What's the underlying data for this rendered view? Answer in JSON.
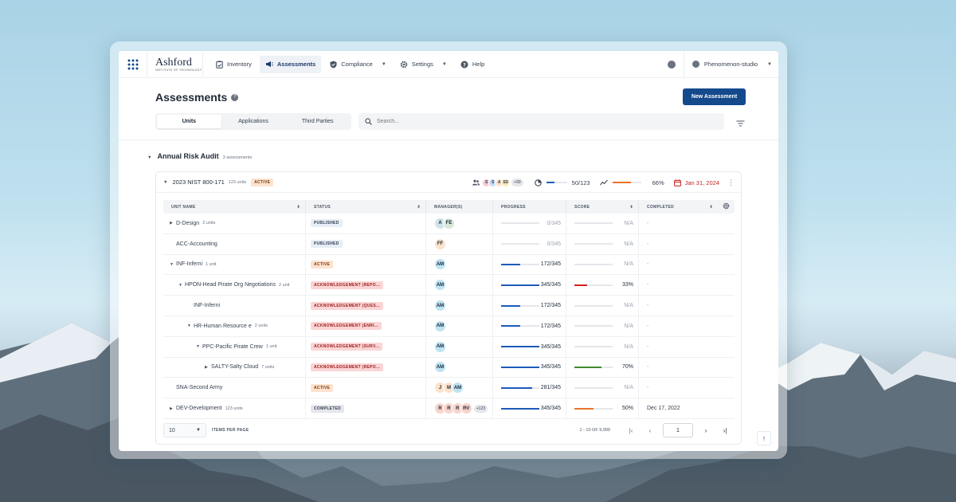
{
  "colors": {
    "brand": "#144a8c",
    "progress": "#1d5bb8",
    "score_orange": "#e8742a",
    "score_red": "#d21f1f",
    "score_green": "#3f8a2e"
  },
  "nav": {
    "brand_name": "Ashford",
    "brand_sub": "INSTITUTE OF TECHNOLOGY",
    "items": [
      {
        "label": "Inventory",
        "icon": "clipboard-icon"
      },
      {
        "label": "Assessments",
        "icon": "megaphone-icon"
      },
      {
        "label": "Compliance",
        "icon": "shield-check-icon"
      },
      {
        "label": "Settings",
        "icon": "gear-icon"
      },
      {
        "label": "Help",
        "icon": "help-icon"
      }
    ],
    "user": "Phenomenon-studio"
  },
  "page": {
    "title": "Assessments",
    "new_button": "New Assessment",
    "tabs": [
      "Units",
      "Applications",
      "Third Parties"
    ],
    "search_placeholder": "Search..."
  },
  "group": {
    "title": "Annual Risk Audit",
    "count": "3 assessments"
  },
  "assessment": {
    "title": "2023 NIST 800-171",
    "units": "123 units",
    "status": "ACTIVE",
    "managers": [
      "S",
      "S",
      "A",
      "SD"
    ],
    "managers_more": "+99",
    "progress_text": "50/123",
    "progress_value": 0.41,
    "score_text": "66%",
    "score_value": 0.66,
    "due_date": "Jan 31, 2024"
  },
  "table": {
    "headers": [
      "UNIT NAME",
      "STATUS",
      "MANAGER(S)",
      "PROGRESS",
      "SCORE",
      "COMPLETED"
    ],
    "rows": [
      {
        "indent": 0,
        "caret": "right",
        "name": "D-Design",
        "sub": "2 units",
        "status": "PUBLISHED",
        "status_kind": "published",
        "managers": [
          {
            "i": "A",
            "c": "#cfe3ec"
          },
          {
            "i": "FE",
            "c": "#d7e7d9"
          }
        ],
        "more": "",
        "progress": "0/345",
        "pv": 0,
        "score": "N/A",
        "sv": 0,
        "sc": "",
        "completed": "-"
      },
      {
        "indent": 0,
        "caret": "",
        "name": "ACC-Accounting",
        "sub": "",
        "status": "PUBLISHED",
        "status_kind": "published",
        "managers": [
          {
            "i": "FF",
            "c": "#fbe3cc"
          }
        ],
        "more": "",
        "progress": "0/345",
        "pv": 0,
        "score": "N/A",
        "sv": 0,
        "sc": "",
        "completed": "-"
      },
      {
        "indent": 0,
        "caret": "down",
        "name": "INF-Inferni",
        "sub": "1 unit",
        "status": "ACTIVE",
        "status_kind": "active",
        "managers": [
          {
            "i": "AM",
            "c": "#bfe3f2"
          }
        ],
        "more": "",
        "progress": "172/345",
        "pv": 0.5,
        "score": "N/A",
        "sv": 0,
        "sc": "",
        "completed": "-"
      },
      {
        "indent": 1,
        "caret": "down",
        "name": "HPON-Head Pirate Org Negotiations",
        "sub": "2 unit",
        "status": "ACKNOWLEDGEMENT (REPO...",
        "status_kind": "ack",
        "managers": [
          {
            "i": "AM",
            "c": "#bfe3f2"
          }
        ],
        "more": "",
        "progress": "345/345",
        "pv": 1,
        "score": "33%",
        "sv": 0.33,
        "sc": "red",
        "completed": "-"
      },
      {
        "indent": 2,
        "caret": "",
        "name": "INF-Inferni",
        "sub": "",
        "status": "ACKNOWLEDGEMENT (QUES...",
        "status_kind": "ack",
        "managers": [
          {
            "i": "AM",
            "c": "#bfe3f2"
          }
        ],
        "more": "",
        "progress": "172/345",
        "pv": 0.5,
        "score": "N/A",
        "sv": 0,
        "sc": "",
        "completed": "-"
      },
      {
        "indent": 2,
        "caret": "down",
        "name": "HR-Human Resource e",
        "sub": "2 units",
        "status": "ACKNOWLEDGEMENT (ENRI...",
        "status_kind": "ack",
        "managers": [
          {
            "i": "AM",
            "c": "#bfe3f2"
          }
        ],
        "more": "",
        "progress": "172/345",
        "pv": 0.5,
        "score": "N/A",
        "sv": 0,
        "sc": "",
        "completed": "-"
      },
      {
        "indent": 3,
        "caret": "down",
        "name": "PPC-Pacific Pirate Crew",
        "sub": "1 unit",
        "status": "ACKNOWLEDGEMENT (SURV...",
        "status_kind": "ack",
        "managers": [
          {
            "i": "AM",
            "c": "#bfe3f2"
          }
        ],
        "more": "",
        "progress": "345/345",
        "pv": 1,
        "score": "N/A",
        "sv": 0,
        "sc": "",
        "completed": "-"
      },
      {
        "indent": 4,
        "caret": "right",
        "name": "SALTY-Salty Cloud",
        "sub": "7 units",
        "status": "ACKNOWLEDGEMENT (REPO...",
        "status_kind": "ack",
        "managers": [
          {
            "i": "AM",
            "c": "#bfe3f2"
          }
        ],
        "more": "",
        "progress": "345/345",
        "pv": 1,
        "score": "70%",
        "sv": 0.7,
        "sc": "green",
        "completed": "-"
      },
      {
        "indent": 0,
        "caret": "",
        "name": "SNA-Second Army",
        "sub": "",
        "status": "ACTIVE",
        "status_kind": "active",
        "managers": [
          {
            "i": "J",
            "c": "#fbe3cc"
          },
          {
            "i": "M",
            "c": "#fbe3cc"
          },
          {
            "i": "AM",
            "c": "#bfe3f2"
          }
        ],
        "more": "",
        "progress": "281/345",
        "pv": 0.81,
        "score": "N/A",
        "sv": 0,
        "sc": "",
        "completed": "-"
      },
      {
        "indent": 0,
        "caret": "right",
        "name": "DEV-Development",
        "sub": "123 units",
        "status": "COMPLETED",
        "status_kind": "completed",
        "managers": [
          {
            "i": "R",
            "c": "#f8d4cc"
          },
          {
            "i": "R",
            "c": "#f8d4cc"
          },
          {
            "i": "R",
            "c": "#f8d4cc"
          },
          {
            "i": "RV",
            "c": "#f8d4cc"
          }
        ],
        "more": "+123",
        "progress": "345/345",
        "pv": 1,
        "score": "50%",
        "sv": 0.5,
        "sc": "orange",
        "completed": "Dec 17, 2022"
      }
    ]
  },
  "footer": {
    "per_page": "10",
    "per_page_label": "ITEMS PER PAGE",
    "range": "1 - 10 OF 9,999",
    "page": "1"
  }
}
